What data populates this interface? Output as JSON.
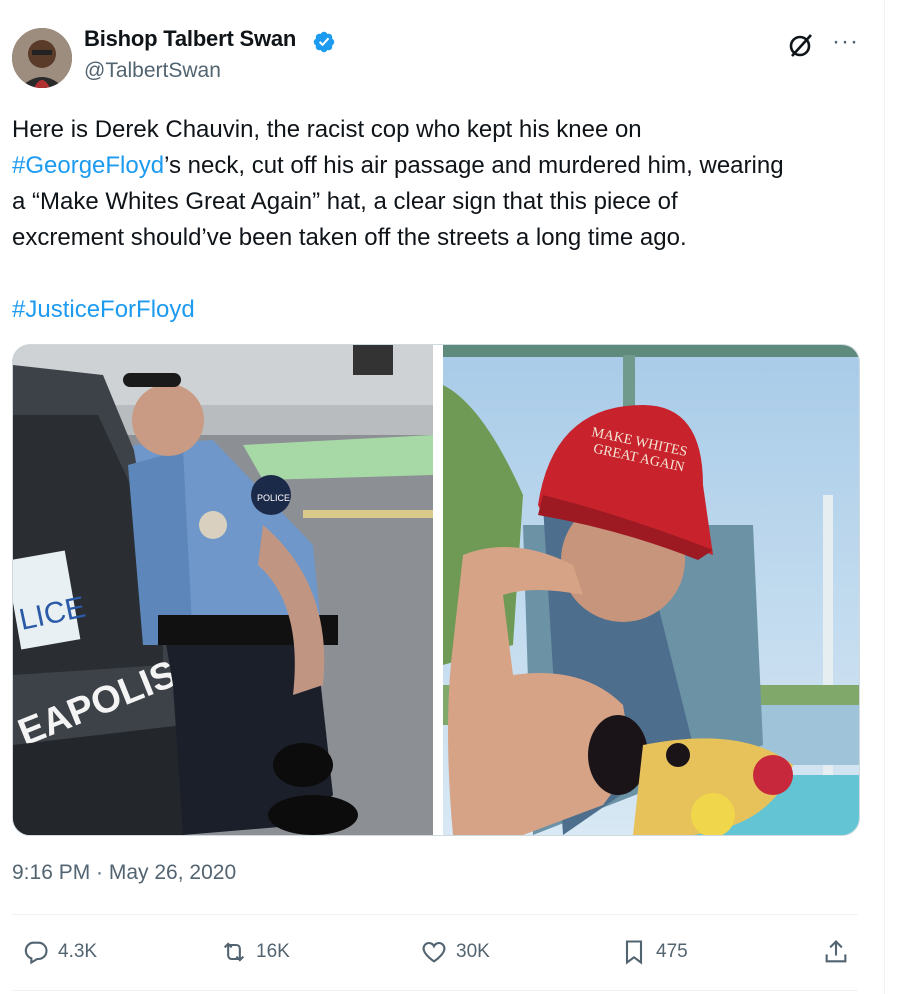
{
  "author": {
    "name": "Bishop Talbert Swan",
    "handle": "@TalbertSwan"
  },
  "tweet": {
    "line1": "Here is Derek Chauvin, the racist cop who kept his knee on",
    "hashtag1": "#GeorgeFloyd",
    "line2_rest": "’s neck, cut off his air passage and murdered him, wearing",
    "line3": "a “Make Whites Great Again” hat, a clear sign that this piece of",
    "line4": "excrement should’ve been taken off the streets a long time ago.",
    "hashtag2": "#JusticeForFloyd"
  },
  "media": {
    "left_photo_text": [
      "LICE",
      "EAPOLIS",
      "POLICE"
    ],
    "right_photo_hat_text": [
      "MAKE WHITES",
      "GREAT AGAIN"
    ]
  },
  "timestamp": "9:16 PM · May 26, 2020",
  "actions": {
    "replies": "4.3K",
    "reposts": "16K",
    "likes": "30K",
    "bookmarks": "475"
  },
  "colors": {
    "link": "#1d9bf0",
    "secondary_text": "#536471",
    "border": "#cfd9de",
    "hat_red": "#c8232c"
  },
  "icons": [
    "verified-badge-icon",
    "grok-icon",
    "more-icon",
    "reply-icon",
    "repost-icon",
    "like-icon",
    "bookmark-icon",
    "share-icon"
  ]
}
